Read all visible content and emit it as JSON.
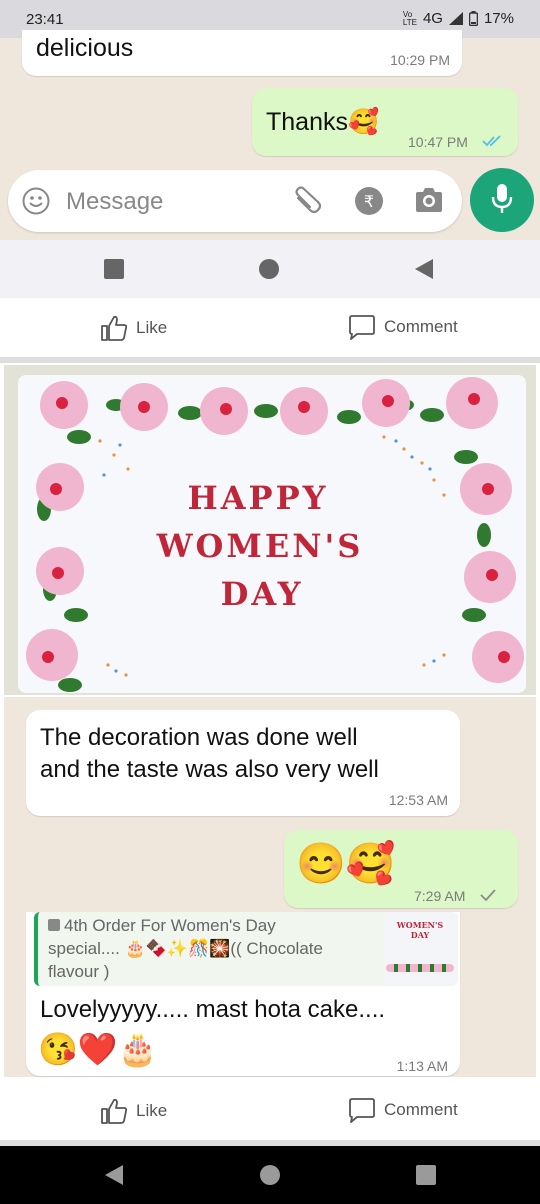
{
  "status_bar": {
    "time": "23:41",
    "network": "4G",
    "battery": "17%"
  },
  "chat_top": {
    "msg_in": {
      "text": "delicious",
      "time": "10:29 PM"
    },
    "msg_out": {
      "text": "Thanks",
      "time": "10:47 PM"
    },
    "input_placeholder": "Message"
  },
  "post_actions": {
    "like_label": "Like",
    "comment_label": "Comment"
  },
  "cake_image": {
    "line1": "HAPPY",
    "line2": "WOMEN'S",
    "line3": "DAY"
  },
  "chat_bottom": {
    "msg_in_1": {
      "line1": "The decoration was done well",
      "line2": "and the taste was also very well",
      "time": "12:53 AM"
    },
    "msg_out_1": {
      "emojis": "😊🥰",
      "time": "7:29 AM"
    },
    "msg_in_2": {
      "quote_line1": "4th Order For Women's Day",
      "quote_line2": "special.... 🎂🍫✨🎊🎇(( Chocolate",
      "quote_line3": "flavour )",
      "thumb_text": "WOMEN'S DAY",
      "text": "Lovelyyyyy..... mast hota cake....",
      "emojis": "😘❤️🎂",
      "time": "1:13 AM"
    }
  },
  "post_actions_2": {
    "like_label": "Like",
    "comment_label": "Comment"
  },
  "colors": {
    "mic": "#1da57a",
    "out_bubble": "#dcf8c6",
    "chat_bg": "#efe6dc",
    "cake_text": "#c0263a",
    "tick_blue": "#53bdeb"
  }
}
